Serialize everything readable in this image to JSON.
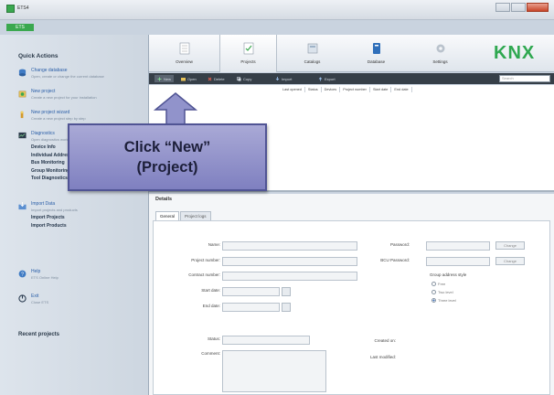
{
  "window": {
    "title": "ETS4",
    "green_tab": "ETS"
  },
  "sidebar": {
    "title": "Quick Actions",
    "items": [
      {
        "label": "Change database",
        "sub": "Open, create or change the current database"
      },
      {
        "label": "New project",
        "sub": "Create a new project for your installation"
      },
      {
        "label": "New project wizard",
        "sub": "Create a new project step by step"
      },
      {
        "label": "Diagnostics",
        "sub": "Open diagnostics workspace"
      },
      {
        "label": "Import Data",
        "sub": "Import projects and products"
      },
      {
        "label": "Help",
        "sub": "ETS Online Help"
      },
      {
        "label": "Exit",
        "sub": "Close ETS"
      }
    ],
    "diag_links": [
      "Device Info",
      "Individual Addresses",
      "Bus Monitoring",
      "Group Monitoring",
      "Tool Diagnostics"
    ],
    "import_links": [
      "Import Projects",
      "Import Products"
    ],
    "recent_title": "Recent projects"
  },
  "toolbar": {
    "buttons": [
      {
        "label": "Overview",
        "icon": "overview-icon"
      },
      {
        "label": "Projects",
        "icon": "projects-icon"
      },
      {
        "label": "Catalogs",
        "icon": "catalogs-icon"
      },
      {
        "label": "Database",
        "icon": "database-icon"
      },
      {
        "label": "Settings",
        "icon": "settings-icon"
      }
    ],
    "logo": "KNX"
  },
  "project_bar": {
    "items": [
      "New",
      "Open",
      "Delete",
      "Copy",
      "Import",
      "Export"
    ],
    "search_placeholder": "Search"
  },
  "columns": [
    "Last opened",
    "Status",
    "Devices",
    "Project number",
    "Start date",
    "End date"
  ],
  "details": {
    "title": "Details",
    "tabs": [
      "General",
      "Project logs"
    ],
    "labels": {
      "name": "Name:",
      "project_number": "Project number:",
      "contract_number": "Contract number:",
      "start_date": "Start date:",
      "end_date": "End date:",
      "status": "Status:",
      "comment": "Comment:",
      "password": "Password:",
      "bcu_password": "BCU Password:",
      "bus_style": "Group address style",
      "created_on": "Created on:",
      "last_modified": "Last modified:"
    },
    "change_button": "Change",
    "radio_options": [
      "Free",
      "Two level",
      "Three level"
    ],
    "radio_selected": 2
  },
  "callout": {
    "line1": "Click “New”",
    "line2": "(Project)"
  },
  "colors": {
    "accent_green": "#2fa850",
    "callout_fill": "#9495cc",
    "dark_bar": "#363f48"
  }
}
